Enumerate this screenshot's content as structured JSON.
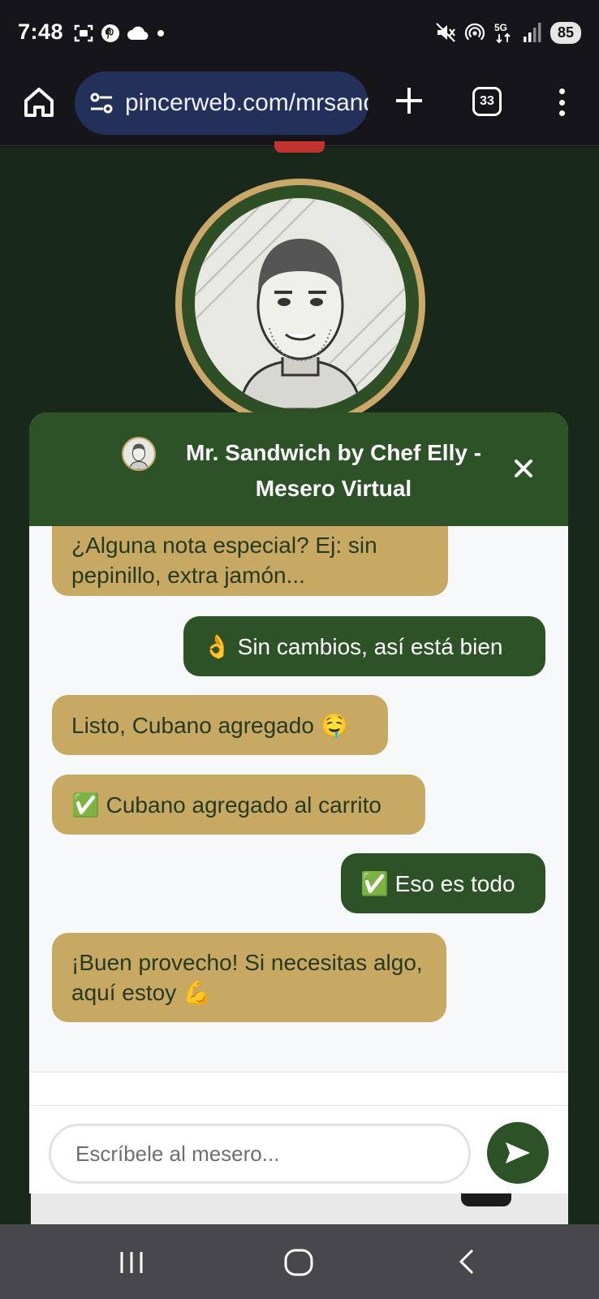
{
  "status_bar": {
    "time": "7:48",
    "battery": "85",
    "left_icons": [
      "screenshot-icon",
      "pinterest-icon",
      "cloud-icon",
      "dot-icon"
    ],
    "right_icons": [
      "mute-icon",
      "hotspot-icon",
      "5g-icon",
      "signal-icon"
    ]
  },
  "browser": {
    "url": "pincerweb.com/mrsandwich",
    "tab_count": "33"
  },
  "chat": {
    "title": "Mr. Sandwich by Chef Elly - Mesero Virtual",
    "messages": [
      {
        "from": "bot",
        "text": "¿Alguna nota especial? Ej: sin pepinillo, extra jamón..."
      },
      {
        "from": "user",
        "text": "👌 Sin cambios, así está bien"
      },
      {
        "from": "bot",
        "text": "Listo, Cubano agregado 🤤"
      },
      {
        "from": "bot",
        "text": "✅ Cubano agregado al carrito"
      },
      {
        "from": "user",
        "text": "✅ Eso es todo"
      },
      {
        "from": "bot",
        "text": "¡Buen provecho! Si necesitas algo, aquí estoy 💪"
      }
    ],
    "input_placeholder": "Escríbele al mesero..."
  },
  "colors": {
    "header_green": "#2d5228",
    "bot_bubble": "#c8a964",
    "user_bubble": "#2d5228",
    "page_bg": "#18281a"
  }
}
